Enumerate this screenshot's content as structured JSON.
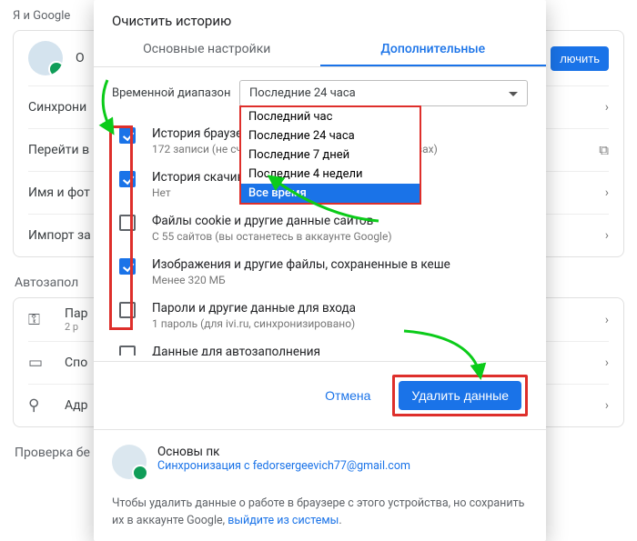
{
  "backdrop": {
    "header": "Я и Google",
    "profile_initial": "О",
    "enable_btn": "лючить",
    "rows": [
      "Синхрони",
      "Перейти в",
      "Имя и фот",
      "Импорт за"
    ],
    "section2": "Автозапол",
    "row2": [
      {
        "label": "Пар",
        "sub": "2 р"
      },
      {
        "label": "Спо",
        "sub": ""
      },
      {
        "label": "Адр",
        "sub": ""
      }
    ],
    "section3": "Проверка бе"
  },
  "dialog": {
    "title": "Очистить историю",
    "tabs": {
      "basic": "Основные настройки",
      "advanced": "Дополнительные"
    },
    "range_label": "Временной диапазон",
    "range_value": "Последние 24 часа",
    "dropdown": [
      "Последний час",
      "Последние 24 часа",
      "Последние 7 дней",
      "Последние 4 недели",
      "Все время"
    ],
    "dropdown_highlight": 4,
    "items": [
      {
        "checked": true,
        "title": "История браузера",
        "sub": "172 записи (не считая синхронизируемых устройствах)"
      },
      {
        "checked": true,
        "title": "История скачива",
        "sub": "Нет"
      },
      {
        "checked": false,
        "title": "Файлы cookie и другие данные сайтов",
        "sub": "С 55 сайтов (вы останетесь в аккаунте Google)"
      },
      {
        "checked": true,
        "title": "Изображения и другие файлы, сохраненные в кеше",
        "sub": "Менее 320 МБ"
      },
      {
        "checked": false,
        "title": "Пароли и другие данные для входа",
        "sub": "1 пароль (для ivi.ru, синхронизировано)"
      },
      {
        "checked": false,
        "title": "Данные для автозаполнения",
        "sub": ""
      }
    ],
    "cancel": "Отмена",
    "delete": "Удалить данные",
    "sync_name": "Основы пк",
    "sync_email": "Синхронизация с fedorsergeevich77@gmail.com",
    "footnote_pre": "Чтобы удалить данные о работе в браузере с этого устройства, но сохранить их в аккаунте Google, ",
    "footnote_link": "выйдите из системы",
    "footnote_post": "."
  }
}
